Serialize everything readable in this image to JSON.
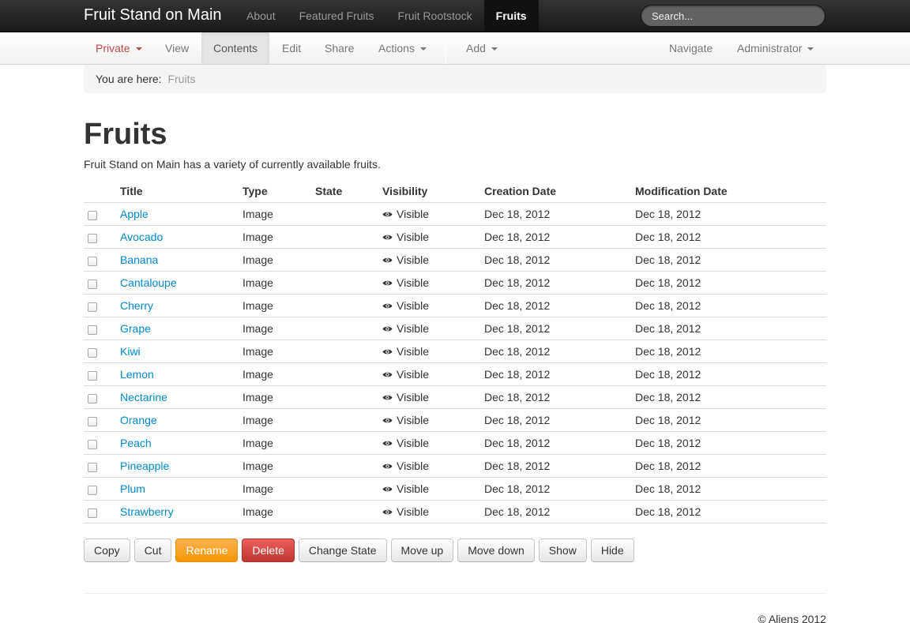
{
  "brand": "Fruit Stand on Main",
  "topnav": [
    "About",
    "Featured Fruits",
    "Fruit Rootstock",
    "Fruits"
  ],
  "search": {
    "placeholder": "Search..."
  },
  "editbar": {
    "private": "Private",
    "view": "View",
    "contents": "Contents",
    "edit": "Edit",
    "share": "Share",
    "actions": "Actions",
    "add": "Add",
    "navigate": "Navigate",
    "administrator": "Administrator"
  },
  "breadcrumb": {
    "here": "You are here:",
    "current": "Fruits"
  },
  "page": {
    "title": "Fruits",
    "description": "Fruit Stand on Main has a variety of currently available fruits."
  },
  "table": {
    "headers": [
      "Title",
      "Type",
      "State",
      "Visibility",
      "Creation Date",
      "Modification Date"
    ],
    "rows": [
      {
        "title": "Apple",
        "type": "Image",
        "state": "",
        "visibility": "Visible",
        "created": "Dec 18, 2012",
        "modified": "Dec 18, 2012"
      },
      {
        "title": "Avocado",
        "type": "Image",
        "state": "",
        "visibility": "Visible",
        "created": "Dec 18, 2012",
        "modified": "Dec 18, 2012"
      },
      {
        "title": "Banana",
        "type": "Image",
        "state": "",
        "visibility": "Visible",
        "created": "Dec 18, 2012",
        "modified": "Dec 18, 2012"
      },
      {
        "title": "Cantaloupe",
        "type": "Image",
        "state": "",
        "visibility": "Visible",
        "created": "Dec 18, 2012",
        "modified": "Dec 18, 2012"
      },
      {
        "title": "Cherry",
        "type": "Image",
        "state": "",
        "visibility": "Visible",
        "created": "Dec 18, 2012",
        "modified": "Dec 18, 2012"
      },
      {
        "title": "Grape",
        "type": "Image",
        "state": "",
        "visibility": "Visible",
        "created": "Dec 18, 2012",
        "modified": "Dec 18, 2012"
      },
      {
        "title": "Kiwi",
        "type": "Image",
        "state": "",
        "visibility": "Visible",
        "created": "Dec 18, 2012",
        "modified": "Dec 18, 2012"
      },
      {
        "title": "Lemon",
        "type": "Image",
        "state": "",
        "visibility": "Visible",
        "created": "Dec 18, 2012",
        "modified": "Dec 18, 2012"
      },
      {
        "title": "Nectarine",
        "type": "Image",
        "state": "",
        "visibility": "Visible",
        "created": "Dec 18, 2012",
        "modified": "Dec 18, 2012"
      },
      {
        "title": "Orange",
        "type": "Image",
        "state": "",
        "visibility": "Visible",
        "created": "Dec 18, 2012",
        "modified": "Dec 18, 2012"
      },
      {
        "title": "Peach",
        "type": "Image",
        "state": "",
        "visibility": "Visible",
        "created": "Dec 18, 2012",
        "modified": "Dec 18, 2012"
      },
      {
        "title": "Pineapple",
        "type": "Image",
        "state": "",
        "visibility": "Visible",
        "created": "Dec 18, 2012",
        "modified": "Dec 18, 2012"
      },
      {
        "title": "Plum",
        "type": "Image",
        "state": "",
        "visibility": "Visible",
        "created": "Dec 18, 2012",
        "modified": "Dec 18, 2012"
      },
      {
        "title": "Strawberry",
        "type": "Image",
        "state": "",
        "visibility": "Visible",
        "created": "Dec 18, 2012",
        "modified": "Dec 18, 2012"
      }
    ]
  },
  "buttons": [
    "Copy",
    "Cut",
    "Rename",
    "Delete",
    "Change State",
    "Move up",
    "Move down",
    "Show",
    "Hide"
  ],
  "footer": {
    "copyright": "© Aliens 2012"
  },
  "icons": {
    "visibility": "eye-icon",
    "menu": "caret-down-icon"
  },
  "colors": {
    "link": "#0088cc",
    "private": "#b94a48",
    "warning": "#f89406",
    "danger": "#bd362f"
  }
}
